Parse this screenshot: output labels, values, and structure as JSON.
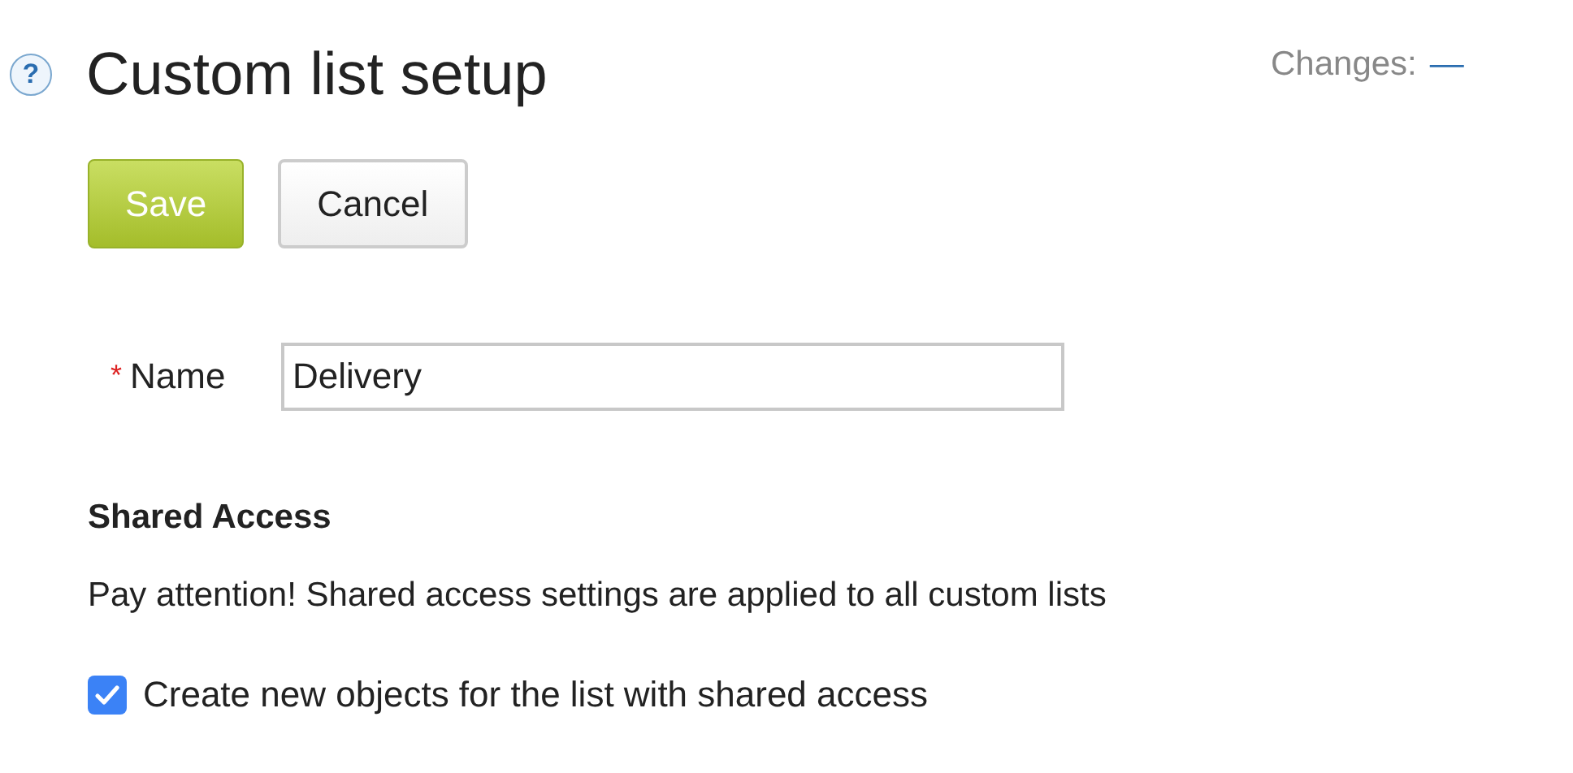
{
  "header": {
    "help_icon": "?",
    "title": "Custom list setup",
    "changes_label": "Changes:",
    "changes_value": "—"
  },
  "buttons": [
    {
      "label": "Save",
      "kind": "primary"
    },
    {
      "label": "Cancel",
      "kind": "secondary"
    }
  ],
  "name_field": {
    "required_mark": "*",
    "label": "Name",
    "value": "Delivery"
  },
  "shared_access": {
    "heading": "Shared Access",
    "notice": "Pay attention! Shared access settings are applied to all custom lists",
    "checkbox": {
      "label": "Create new objects for the list with shared access",
      "checked": true
    }
  }
}
